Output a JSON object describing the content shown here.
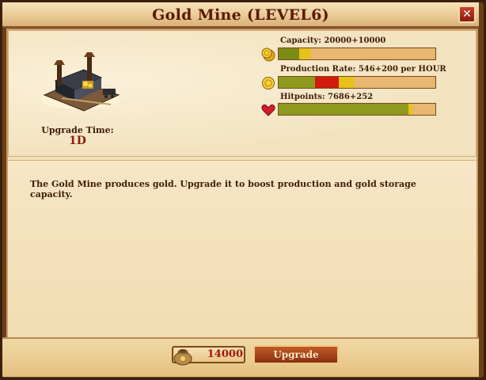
{
  "window": {
    "title": "Gold Mine (LEVEL6)",
    "close_label": "✕"
  },
  "building": {
    "icon": "gold-mine-building",
    "upgrade_time_label": "Upgrade Time:",
    "upgrade_time_value": "1D"
  },
  "stats": {
    "capacity": {
      "label": "Capacity: 20000+10000",
      "icon": "gold-coins-icon",
      "current": 20000,
      "bonus": 10000
    },
    "production": {
      "label": "Production Rate: 546+200 per HOUR",
      "icon": "gold-coin-icon",
      "current": 546,
      "bonus": 200
    },
    "hitpoints": {
      "label": "Hitpoints: 7686+252",
      "icon": "heart-icon",
      "current": 7686,
      "bonus": 252
    }
  },
  "description": "The Gold Mine produces gold. Upgrade it to boost production and gold storage capacity.",
  "footer": {
    "cost_value": "14000",
    "cost_icon": "gold-bag-icon",
    "upgrade_label": "Upgrade"
  },
  "colors": {
    "title": "#5a1a08",
    "bar_green": "#8d9a1e",
    "bar_yellow": "#e7c21a",
    "bar_red": "#d11b0c",
    "cost_text": "#a3160a"
  }
}
